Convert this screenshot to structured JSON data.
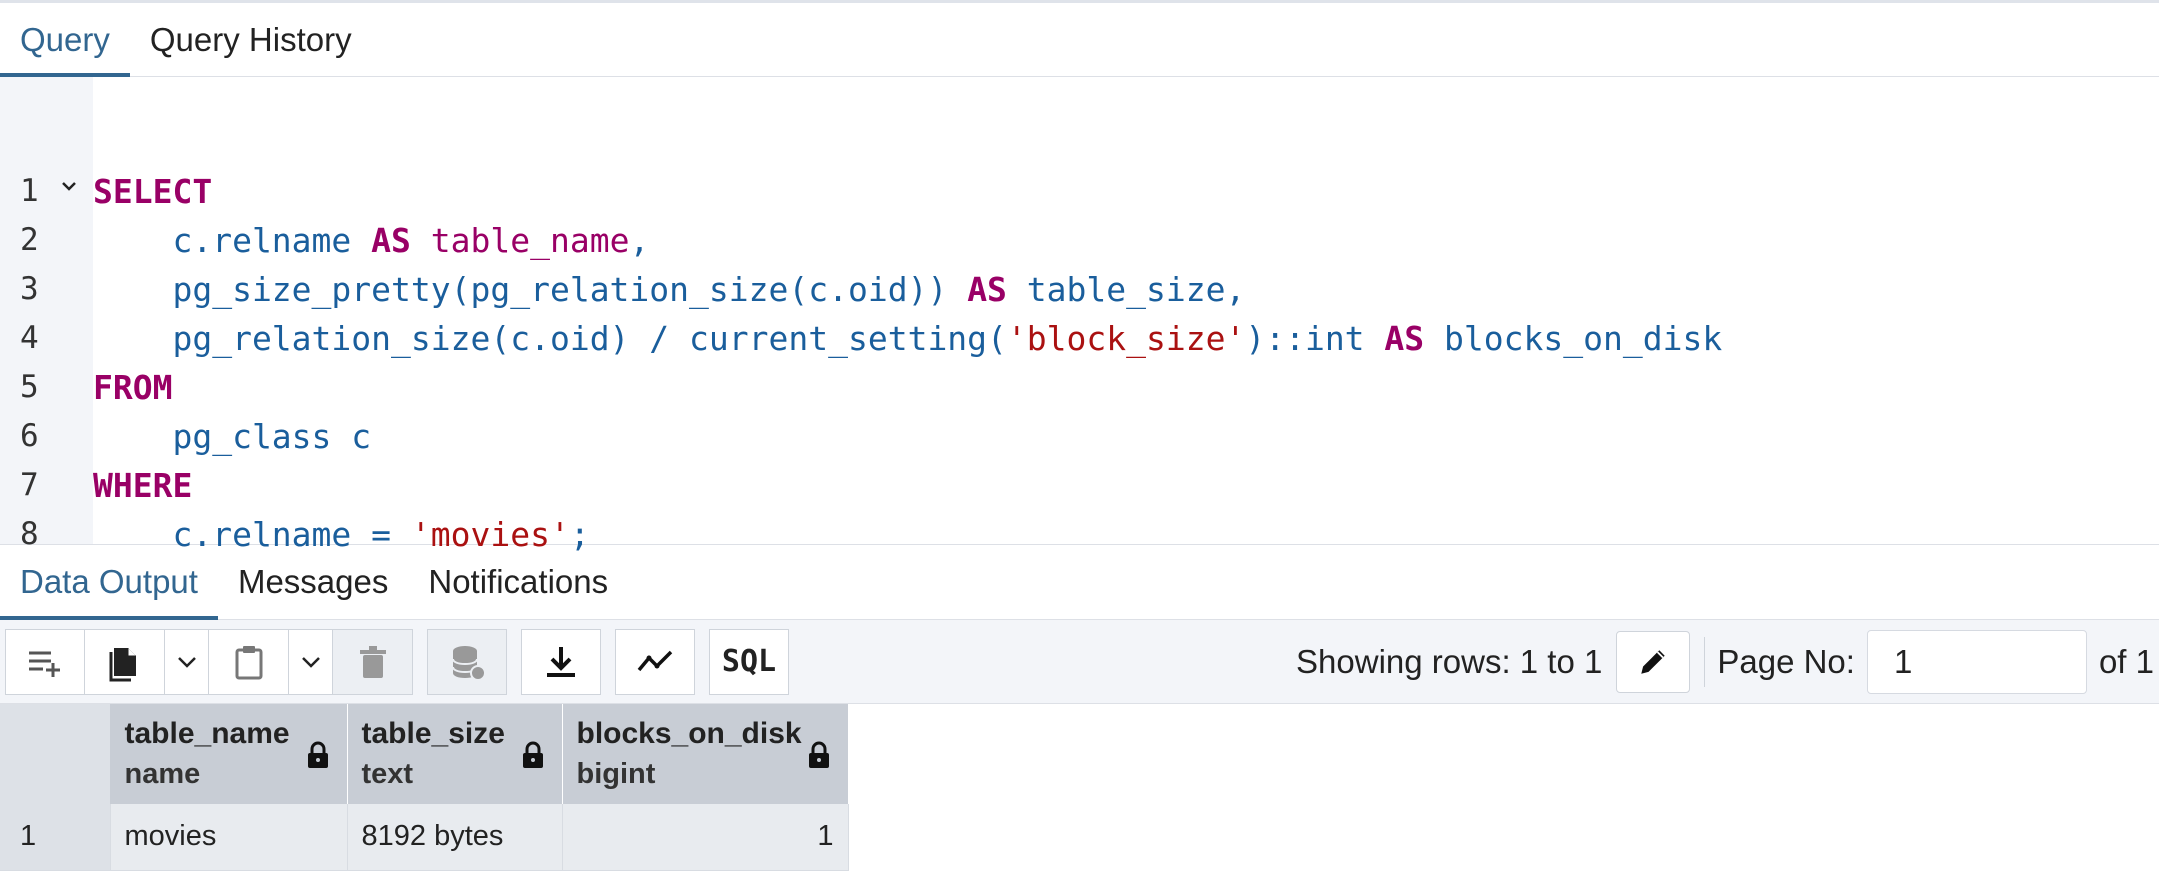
{
  "query_tabs": [
    {
      "label": "Query",
      "active": true
    },
    {
      "label": "Query History",
      "active": false
    }
  ],
  "editor": {
    "line_numbers": [
      "1",
      "2",
      "3",
      "4",
      "5",
      "6",
      "7",
      "8"
    ],
    "lines": [
      [
        {
          "t": "kw",
          "v": "SELECT"
        }
      ],
      [
        {
          "t": "p",
          "v": "    c.relname "
        },
        {
          "t": "kw",
          "v": "AS"
        },
        {
          "t": "idb",
          "v": " table_name"
        },
        {
          "t": "p",
          "v": ","
        }
      ],
      [
        {
          "t": "p",
          "v": "    pg_size_pretty(pg_relation_size(c.oid)) "
        },
        {
          "t": "kw",
          "v": "AS"
        },
        {
          "t": "p",
          "v": " table_size,"
        }
      ],
      [
        {
          "t": "p",
          "v": "    pg_relation_size(c.oid) / current_setting("
        },
        {
          "t": "str",
          "v": "'block_size'"
        },
        {
          "t": "p",
          "v": ")::int "
        },
        {
          "t": "kw",
          "v": "AS"
        },
        {
          "t": "p",
          "v": " blocks_on_disk"
        }
      ],
      [
        {
          "t": "kw",
          "v": "FROM"
        }
      ],
      [
        {
          "t": "p",
          "v": "    pg_class c"
        }
      ],
      [
        {
          "t": "kw",
          "v": "WHERE"
        }
      ],
      [
        {
          "t": "p",
          "v": "    c.relname = "
        },
        {
          "t": "str",
          "v": "'movies'"
        },
        {
          "t": "p",
          "v": ";"
        }
      ]
    ]
  },
  "output_tabs": [
    {
      "label": "Data Output",
      "active": true
    },
    {
      "label": "Messages",
      "active": false
    },
    {
      "label": "Notifications",
      "active": false
    }
  ],
  "toolbar": {
    "sql_label": "SQL",
    "rows_info": "Showing rows: 1 to 1",
    "page_label": "Page No:",
    "page_value": "1",
    "page_of": "of 1"
  },
  "grid": {
    "columns": [
      {
        "name": "table_name",
        "type": "name"
      },
      {
        "name": "table_size",
        "type": "text"
      },
      {
        "name": "blocks_on_disk",
        "type": "bigint"
      }
    ],
    "rows": [
      {
        "num": "1",
        "cells": [
          "movies",
          "8192 bytes",
          "1"
        ]
      }
    ]
  },
  "colors": {
    "accent": "#326690",
    "keyword": "#990066",
    "identifier": "#1a5e9c",
    "string": "#aa1111",
    "header_bg": "#c8cdd5",
    "toolbar_bg": "#f3f5f9"
  }
}
